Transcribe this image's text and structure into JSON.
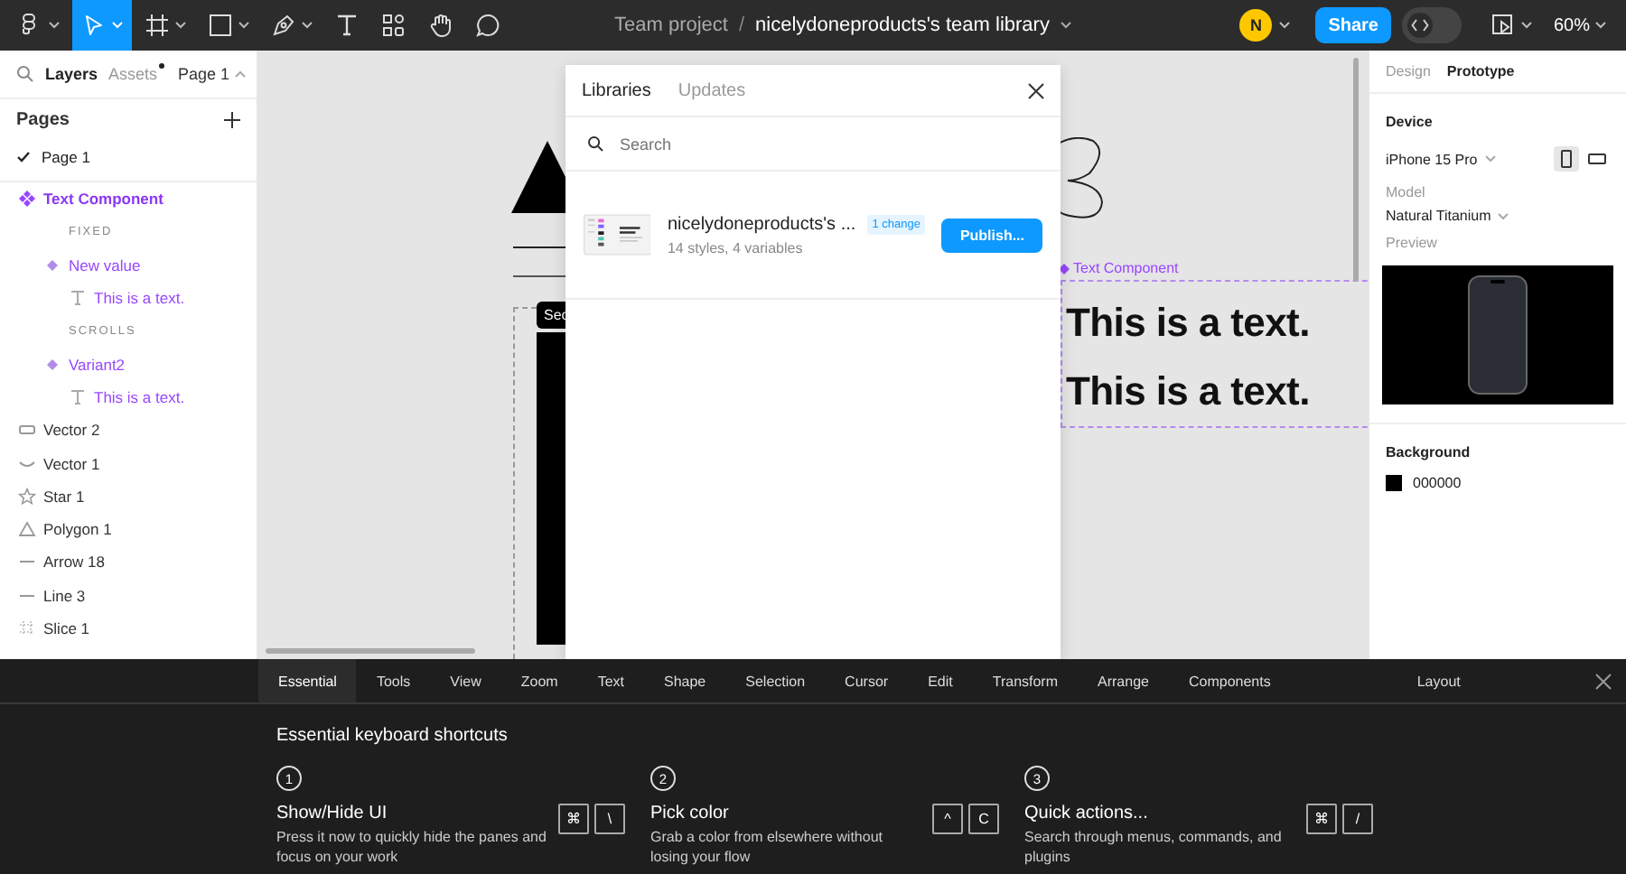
{
  "toolbar": {
    "tools": [
      {
        "kind": "main-menu",
        "selected": false,
        "dropdown": true
      },
      {
        "kind": "move",
        "selected": true,
        "dropdown": true
      },
      {
        "kind": "frame",
        "selected": false,
        "dropdown": true
      },
      {
        "kind": "shape",
        "selected": false,
        "dropdown": true
      },
      {
        "kind": "pen",
        "selected": false,
        "dropdown": true
      },
      {
        "kind": "text",
        "selected": false,
        "dropdown": false
      },
      {
        "kind": "resources",
        "selected": false,
        "dropdown": false
      },
      {
        "kind": "hand",
        "selected": false,
        "dropdown": false
      },
      {
        "kind": "comment",
        "selected": false,
        "dropdown": false
      }
    ],
    "breadcrumb": {
      "project": "Team project",
      "separator": "/",
      "file": "nicelydoneproducts's team library"
    },
    "avatar": "N",
    "share": "Share",
    "dev_mode": {
      "on": false
    },
    "zoom": "60%"
  },
  "left_panel": {
    "tabs": [
      {
        "label": "Layers",
        "selected": true,
        "dot": false
      },
      {
        "label": "Assets",
        "selected": false,
        "dot": true
      }
    ],
    "page_selector": "Page 1",
    "pages_title": "Pages",
    "pages": [
      {
        "label": "Page 1",
        "selected": true
      }
    ],
    "layers": [
      {
        "kind": "component",
        "label": "Text Component",
        "children": [
          {
            "kind": "section-label",
            "label": "FIXED"
          },
          {
            "kind": "variant",
            "label": "New value",
            "children": [
              {
                "kind": "text",
                "label": "This is a text."
              }
            ]
          },
          {
            "kind": "section-label",
            "label": "SCROLLS"
          },
          {
            "kind": "variant",
            "label": "Variant2",
            "children": [
              {
                "kind": "text",
                "label": "This is a text."
              }
            ]
          }
        ]
      },
      {
        "kind": "vector-rect",
        "label": "Vector 2"
      },
      {
        "kind": "vector-curve",
        "label": "Vector 1"
      },
      {
        "kind": "star",
        "label": "Star 1"
      },
      {
        "kind": "polygon",
        "label": "Polygon 1"
      },
      {
        "kind": "arrow",
        "label": "Arrow 18"
      },
      {
        "kind": "line",
        "label": "Line 3"
      },
      {
        "kind": "slice",
        "label": "Slice 1"
      }
    ]
  },
  "canvas": {
    "section_label": "Sec",
    "component_label": "Text Component",
    "texts": [
      "This is a text.",
      "This is a text."
    ]
  },
  "library_modal": {
    "tabs": [
      {
        "label": "Libraries",
        "selected": true
      },
      {
        "label": "Updates",
        "selected": false
      }
    ],
    "search": {
      "placeholder": "Search"
    },
    "library": {
      "name": "nicelydoneproducts's ...",
      "badge": "1 change",
      "meta": "14 styles, 4 variables",
      "action": "Publish..."
    }
  },
  "right_panel": {
    "tabs": [
      {
        "label": "Design",
        "selected": false
      },
      {
        "label": "Prototype",
        "selected": true
      }
    ],
    "device_title": "Device",
    "device": "iPhone 15 Pro",
    "orientations": [
      {
        "kind": "portrait",
        "selected": true
      },
      {
        "kind": "landscape",
        "selected": false
      }
    ],
    "model_label": "Model",
    "model": "Natural Titanium",
    "preview_label": "Preview",
    "background_title": "Background",
    "background": {
      "color": "#000000",
      "hex": "000000"
    }
  },
  "shortcuts_panel": {
    "tabs": [
      {
        "label": "Essential",
        "selected": true
      },
      {
        "label": "Tools",
        "selected": false
      },
      {
        "label": "View",
        "selected": false
      },
      {
        "label": "Zoom",
        "selected": false
      },
      {
        "label": "Text",
        "selected": false
      },
      {
        "label": "Shape",
        "selected": false
      },
      {
        "label": "Selection",
        "selected": false
      },
      {
        "label": "Cursor",
        "selected": false
      },
      {
        "label": "Edit",
        "selected": false
      },
      {
        "label": "Transform",
        "selected": false
      },
      {
        "label": "Arrange",
        "selected": false
      },
      {
        "label": "Components",
        "selected": false
      }
    ],
    "layout_tab": "Layout",
    "title": "Essential keyboard shortcuts",
    "shortcuts": [
      {
        "number": "1",
        "title": "Show/Hide UI",
        "description": "Press it now to quickly hide the panes and focus on your work",
        "keys": [
          "⌘",
          "\\"
        ]
      },
      {
        "number": "2",
        "title": "Pick color",
        "description": "Grab a color from elsewhere without losing your flow",
        "keys": [
          "^",
          "C"
        ]
      },
      {
        "number": "3",
        "title": "Quick actions...",
        "description": "Search through menus, commands, and plugins",
        "keys": [
          "⌘",
          "/"
        ]
      }
    ]
  }
}
